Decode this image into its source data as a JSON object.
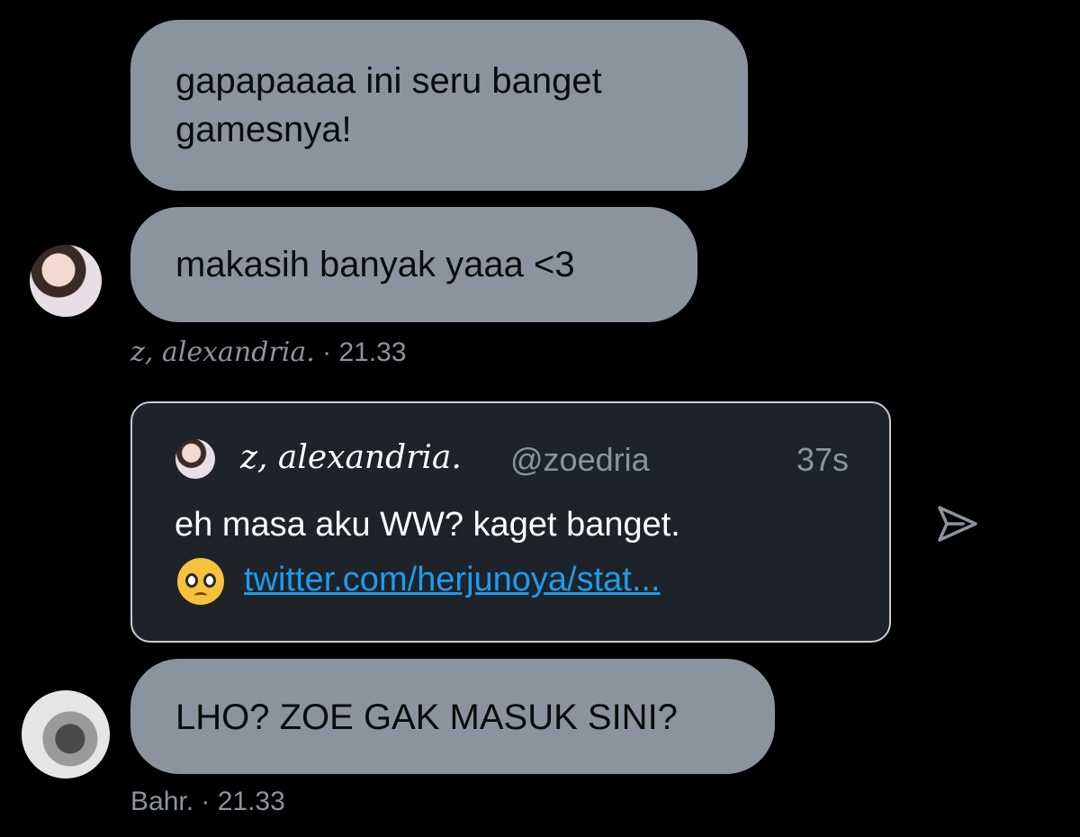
{
  "messages": [
    {
      "text_line1": "gapapaaaa ini seru banget",
      "text_line2": "gamesnya!"
    },
    {
      "text": "makasih banyak yaaa <3"
    },
    {
      "text": "LHO? ZOE GAK MASUK SINI?"
    }
  ],
  "meta_zoe": {
    "name": "z, alexandria.",
    "time": " · 21.33"
  },
  "meta_bahr": {
    "name": "Bahr.",
    "time": " · 21.33"
  },
  "quote": {
    "name": "z, alexandria.",
    "handle": "@zoedria",
    "age": "37s",
    "text": "eh masa aku WW? kaget banget.",
    "emoji": "pleading-face",
    "link": "twitter.com/herjunoya/stat..."
  },
  "icons": {
    "share": "send-arrow-icon"
  },
  "colors": {
    "background": "#000000",
    "bubble": "#8b949e",
    "meta_text": "#8b949e",
    "quote_bg": "#1e2329",
    "link": "#1d9bf0"
  }
}
